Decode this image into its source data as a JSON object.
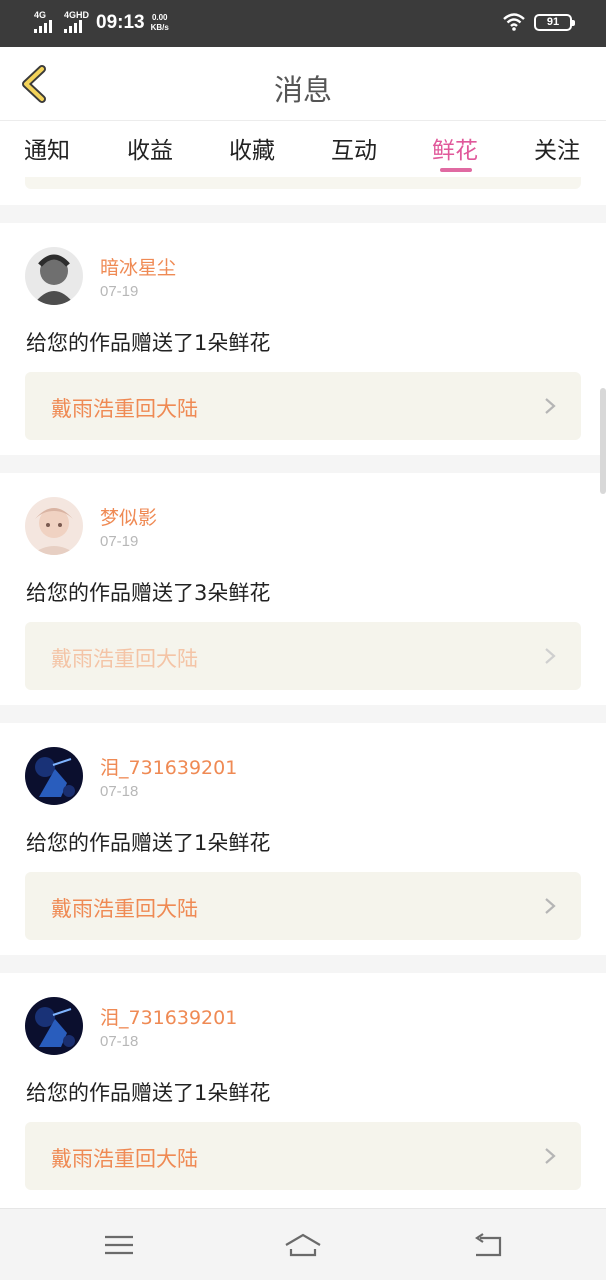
{
  "status_bar": {
    "signal1": "4G",
    "signal2": "4GHD",
    "time": "09:13",
    "speed_value": "0.00",
    "speed_unit": "KB/s",
    "battery": "91"
  },
  "header": {
    "title": "消息"
  },
  "tabs": [
    {
      "label": "通知",
      "active": false
    },
    {
      "label": "收益",
      "active": false
    },
    {
      "label": "收藏",
      "active": false
    },
    {
      "label": "互动",
      "active": false
    },
    {
      "label": "鲜花",
      "active": true
    },
    {
      "label": "关注",
      "active": false
    }
  ],
  "items": [
    {
      "user": "暗冰星尘",
      "date": "07-19",
      "message": "给您的作品赠送了1朵鲜花",
      "work": "戴雨浩重回大陆"
    },
    {
      "user": "梦似影",
      "date": "07-19",
      "message": "给您的作品赠送了3朵鲜花",
      "work": "戴雨浩重回大陆"
    },
    {
      "user": "泪_731639201",
      "date": "07-18",
      "message": "给您的作品赠送了1朵鲜花",
      "work": "戴雨浩重回大陆"
    },
    {
      "user": "泪_731639201",
      "date": "07-18",
      "message": "给您的作品赠送了1朵鲜花",
      "work": "戴雨浩重回大陆"
    }
  ],
  "icons": {
    "back": "chevron-left-icon",
    "row_arrow": "chevron-right-icon",
    "nav_menu": "menu-icon",
    "nav_home": "home-icon",
    "nav_back": "back-icon"
  },
  "colors": {
    "accent_pink": "#e0589a",
    "name_orange": "#ef8a54",
    "card_bg": "#f5f4ec",
    "back_icon_yellow": "#f3d35a"
  }
}
